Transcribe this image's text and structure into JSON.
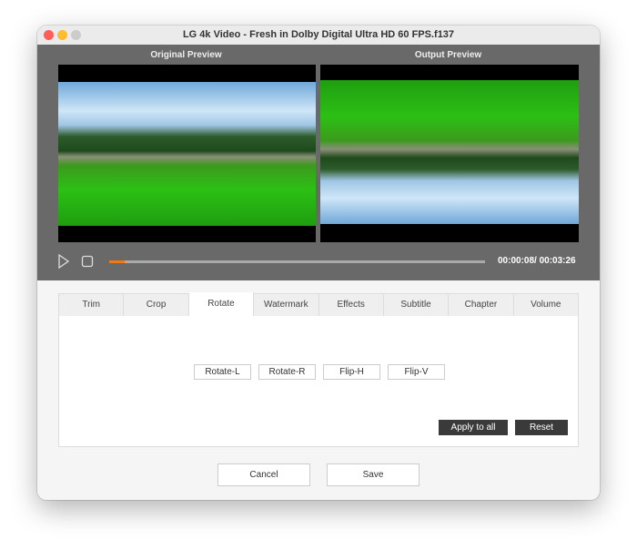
{
  "window": {
    "title": "LG 4k Video - Fresh in Dolby Digital Ultra HD 60 FPS.f137"
  },
  "preview": {
    "original_label": "Original Preview",
    "output_label": "Output  Preview"
  },
  "player": {
    "time": "00:00:08/ 00:03:26",
    "progress_percent": 4,
    "accent": "#f07a12"
  },
  "tabs": [
    "Trim",
    "Crop",
    "Rotate",
    "Watermark",
    "Effects",
    "Subtitle",
    "Chapter",
    "Volume"
  ],
  "active_tab": "Rotate",
  "rotate": {
    "buttons": [
      "Rotate-L",
      "Rotate-R",
      "Flip-H",
      "Flip-V"
    ],
    "apply_all": "Apply to all",
    "reset": "Reset"
  },
  "footer": {
    "cancel": "Cancel",
    "save": "Save"
  }
}
